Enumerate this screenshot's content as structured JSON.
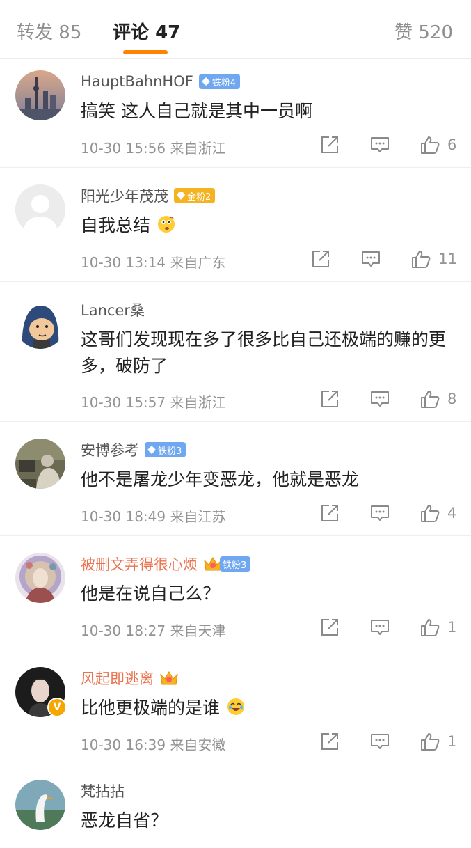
{
  "tabs": {
    "repost": {
      "label": "转发",
      "count": "85"
    },
    "comments": {
      "label": "评论",
      "count": "47"
    },
    "likes": {
      "label": "赞",
      "count": "520"
    }
  },
  "accent_color": "#ff8200",
  "comments": [
    {
      "username": "HauptBahnHOF",
      "badge": "铁粉4",
      "text": "搞笑 这人自己就是其中一员啊",
      "time": "10-30 15:56",
      "location": "来自浙江",
      "likes": "6"
    },
    {
      "username": "阳光少年茂茂",
      "badge": "金粉2",
      "text": "自我总结",
      "time": "10-30 13:14",
      "location": "来自广东",
      "likes": "11"
    },
    {
      "username": "Lancer桑",
      "badge": "",
      "text": "这哥们发现现在多了很多比自己还极端的赚的更多，破防了",
      "time": "10-30 15:57",
      "location": "来自浙江",
      "likes": "8"
    },
    {
      "username": "安博参考",
      "badge": "铁粉3",
      "text": "他不是屠龙少年变恶龙，他就是恶龙",
      "time": "10-30 18:49",
      "location": "来自江苏",
      "likes": "4"
    },
    {
      "username": "被删文弄得很心烦",
      "badge": "铁粉3",
      "text": "他是在说自己么？",
      "time": "10-30 18:27",
      "location": "来自天津",
      "likes": "1"
    },
    {
      "username": "风起即逃离",
      "badge": "",
      "text": "比他更极端的是谁",
      "time": "10-30 16:39",
      "location": "来自安徽",
      "likes": "1"
    },
    {
      "username": "梵拈拈",
      "badge": "",
      "text": "恶龙自省？",
      "time": "",
      "location": "",
      "likes": ""
    }
  ],
  "icons": {
    "share": "share-box-icon",
    "reply": "comment-bubble-icon",
    "like": "thumbs-up-icon",
    "verified": "verified-v-icon",
    "crown": "crown-icon",
    "fan_badge": "diamond-icon"
  }
}
